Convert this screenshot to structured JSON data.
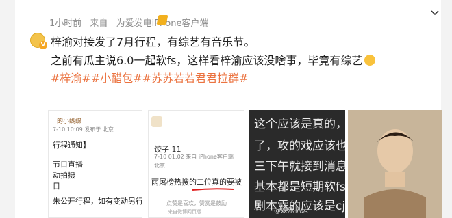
{
  "post": {
    "meta": {
      "time": "1小时前",
      "from": "来自",
      "device": "为爱发电iPhone客户端"
    },
    "lines": [
      "梓渝对接发了7月行程，有综艺有音乐节。",
      "之前有瓜主说6.0一起软fs，这样看梓渝应该没啥事，毕竟有综艺"
    ],
    "hashtags": "#梓渝##小醋包##苏苏若若君君拉群#"
  },
  "thumbs": {
    "t1": {
      "author": "的小蝴蝶",
      "sub": "7-10 10:09 发布于 北京",
      "lines": [
        "行程通知】",
        "节目直播",
        "动拍摄",
        "目",
        "朱公开行程，如有变动另行通知！"
      ]
    },
    "t2": {
      "author": "饺子 11",
      "sub1": "7-10 01:02 来自 iPhone客户端",
      "sub2": "北京",
      "body": "雨屠榜热搜的二位真的要被",
      "foot": "点赞是喜欢，赞赏是鼓励",
      "foot2": "来自微博网页版"
    },
    "t3": {
      "lines": [
        "这个应该是真的，",
        "了，攻的戏应该也",
        "三下午就接到消息",
        "基本都是短期软fs，",
        "剧本露的应该是cj"
      ]
    },
    "watermark": "@娱乐扒边"
  },
  "colors": {
    "hashtag": "#eb7340",
    "meta": "#8a8a8a",
    "underline": "#e02020"
  }
}
